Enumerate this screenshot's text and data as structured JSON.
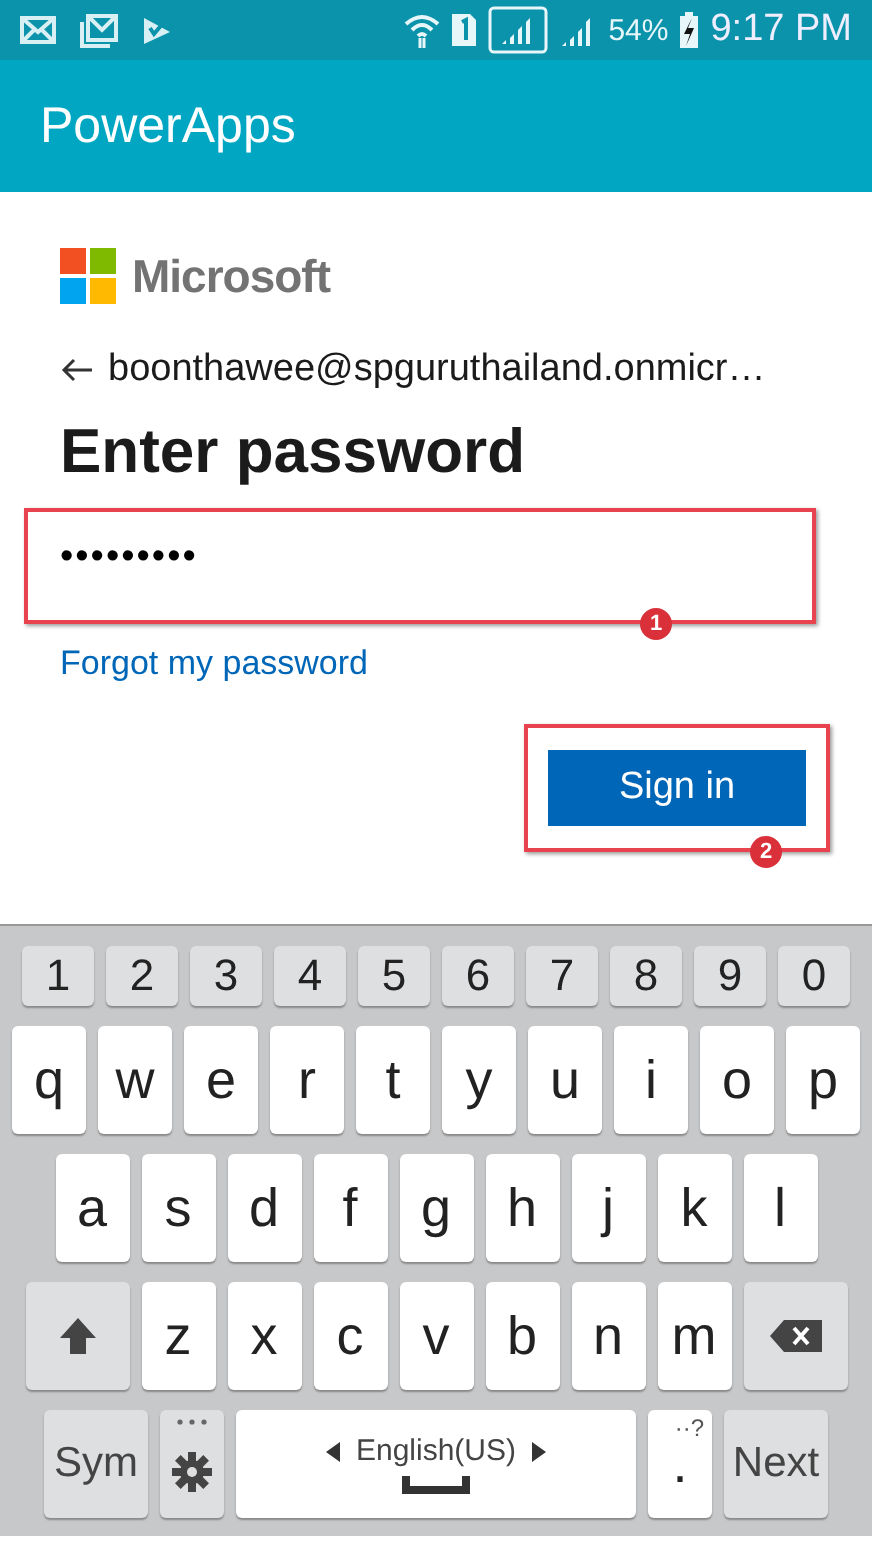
{
  "status_bar": {
    "battery": "54%",
    "time": "9:17 PM"
  },
  "app_bar": {
    "title": "PowerApps"
  },
  "sign_in": {
    "brand": "Microsoft",
    "account": "boonthawee@spguruthailand.onmicr…",
    "heading": "Enter password",
    "password": {
      "value": "•••••••••"
    },
    "forgot_link": "Forgot my password",
    "submit": "Sign in"
  },
  "annotations": [
    {
      "label": "1"
    },
    {
      "label": "2"
    }
  ],
  "keyboard": {
    "number_keys": [
      {
        "kind": "number",
        "label": "1"
      },
      {
        "kind": "number",
        "label": "2"
      },
      {
        "kind": "number",
        "label": "3"
      },
      {
        "kind": "number",
        "label": "4"
      },
      {
        "kind": "number",
        "label": "5"
      },
      {
        "kind": "number",
        "label": "6"
      },
      {
        "kind": "number",
        "label": "7"
      },
      {
        "kind": "number",
        "label": "8"
      },
      {
        "kind": "number",
        "label": "9"
      },
      {
        "kind": "number",
        "label": "0"
      }
    ],
    "top_letter_keys": [
      {
        "kind": "char",
        "label": "q"
      },
      {
        "kind": "char",
        "label": "w"
      },
      {
        "kind": "char",
        "label": "e"
      },
      {
        "kind": "char",
        "label": "r"
      },
      {
        "kind": "char",
        "label": "t"
      },
      {
        "kind": "char",
        "label": "y"
      },
      {
        "kind": "char",
        "label": "u"
      },
      {
        "kind": "char",
        "label": "i"
      },
      {
        "kind": "char",
        "label": "o"
      },
      {
        "kind": "char",
        "label": "p"
      }
    ],
    "middle_letter_keys": [
      {
        "kind": "char",
        "label": "a"
      },
      {
        "kind": "char",
        "label": "s"
      },
      {
        "kind": "char",
        "label": "d"
      },
      {
        "kind": "char",
        "label": "f"
      },
      {
        "kind": "char",
        "label": "g"
      },
      {
        "kind": "char",
        "label": "h"
      },
      {
        "kind": "char",
        "label": "j"
      },
      {
        "kind": "char",
        "label": "k"
      },
      {
        "kind": "char",
        "label": "l"
      }
    ],
    "bottom_letter_keys": [
      {
        "kind": "shift"
      },
      {
        "kind": "char",
        "label": "z"
      },
      {
        "kind": "char",
        "label": "x"
      },
      {
        "kind": "char",
        "label": "c"
      },
      {
        "kind": "char",
        "label": "v"
      },
      {
        "kind": "char",
        "label": "b"
      },
      {
        "kind": "char",
        "label": "n"
      },
      {
        "kind": "char",
        "label": "m"
      },
      {
        "kind": "backspace"
      }
    ],
    "function_keys": [
      {
        "kind": "sym",
        "label": "Sym"
      },
      {
        "kind": "settings"
      },
      {
        "kind": "space",
        "label": "English(US)"
      },
      {
        "kind": "period",
        "label": ".",
        "hint": "··?"
      },
      {
        "kind": "next",
        "label": "Next"
      }
    ]
  }
}
